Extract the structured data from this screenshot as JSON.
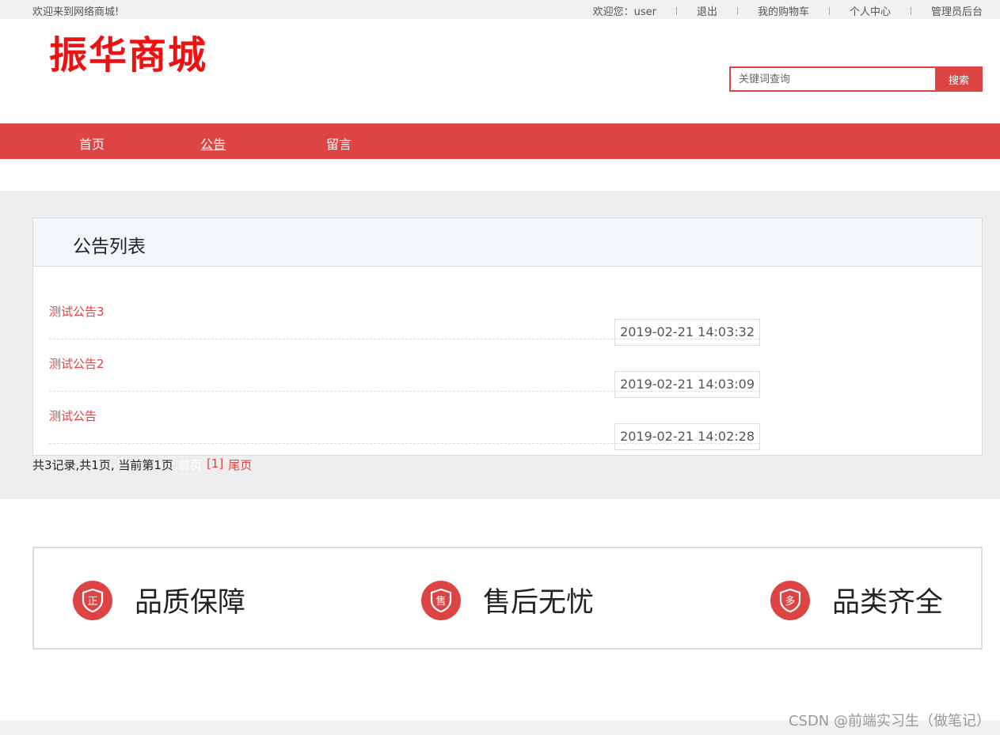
{
  "topbar": {
    "welcome": "欢迎来到网络商城!",
    "links": [
      "欢迎您：user",
      "退出",
      "我的购物车",
      "个人中心",
      "管理员后台"
    ]
  },
  "header": {
    "logo": "振华商城",
    "search_placeholder": "关键词查询",
    "search_button": "搜索"
  },
  "nav": {
    "items": [
      "首页",
      "公告",
      "留言"
    ],
    "active": "公告"
  },
  "panel": {
    "title": "公告列表",
    "notices": [
      {
        "title": "测试公告3",
        "date": "2019-02-21 14:03:32"
      },
      {
        "title": "测试公告2",
        "date": "2019-02-21 14:03:09"
      },
      {
        "title": "测试公告",
        "date": "2019-02-21 14:02:28"
      }
    ]
  },
  "pager": {
    "summary": "共3记录,共1页, 当前第1页",
    "first": "首页",
    "current": "[1]",
    "last": "尾页"
  },
  "features": [
    {
      "label": "品质保障",
      "icon": "shield-zheng-icon",
      "glyph": "正"
    },
    {
      "label": "售后无忧",
      "icon": "shield-shou-icon",
      "glyph": "售"
    },
    {
      "label": "品类齐全",
      "icon": "shield-duo-icon",
      "glyph": "多"
    }
  ],
  "watermark": "CSDN @前端实习生（做笔记）",
  "colors": {
    "accent": "#dd4444",
    "logo": "#ee1111"
  }
}
